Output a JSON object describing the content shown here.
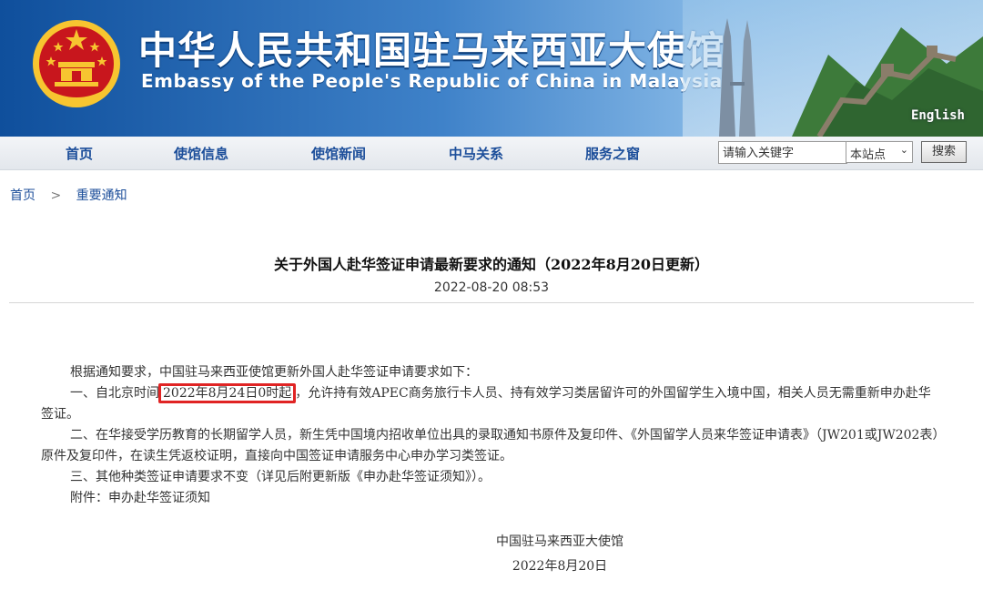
{
  "header": {
    "title_cn": "中华人民共和国驻马来西亚大使馆",
    "title_en": "Embassy of the People's Republic of China in Malaysia",
    "english_link": "English",
    "emblem_icon": "national-emblem-icon",
    "colors": {
      "banner_blue": "#1a5fae",
      "emblem_red": "#c8161d",
      "emblem_gold": "#f7c530"
    }
  },
  "nav": {
    "items": [
      "首页",
      "使馆信息",
      "使馆新闻",
      "中马关系",
      "服务之窗"
    ],
    "search_value": "请输入关键字",
    "scope_value": "本站点",
    "search_button": "搜索"
  },
  "breadcrumb": {
    "home": "首页",
    "separator": ">",
    "current": "重要通知"
  },
  "article": {
    "title": "关于外国人赴华签证申请最新要求的通知（2022年8月20日更新）",
    "date": "2022-08-20 08:53",
    "intro": "根据通知要求，中国驻马来西亚使馆更新外国人赴华签证申请要求如下：",
    "p1_before": "一、自北京时间",
    "p1_highlight": "2022年8月24日0时起",
    "p1_after": "，允许持有效APEC商务旅行卡人员、持有效学习类居留许可的外国留学生入境中国，相关人员无需重新申办赴华签证。",
    "p2": "二、在华接受学历教育的长期留学人员，新生凭中国境内招收单位出具的录取通知书原件及复印件、《外国留学人员来华签证申请表》（JW201或JW202表）原件及复印件，在读生凭返校证明，直接向中国签证申请服务中心申办学习类签证。",
    "p3": "三、其他种类签证申请要求不变（详见后附更新版《申办赴华签证须知》）。",
    "attachment_label": "附件：",
    "attachment_link": "申办赴华签证须知",
    "signature_org": "中国驻马来西亚大使馆",
    "signature_date": "2022年8月20日"
  },
  "accent": {
    "highlight_border": "#e02424",
    "link_color": "#1c4e9a"
  }
}
